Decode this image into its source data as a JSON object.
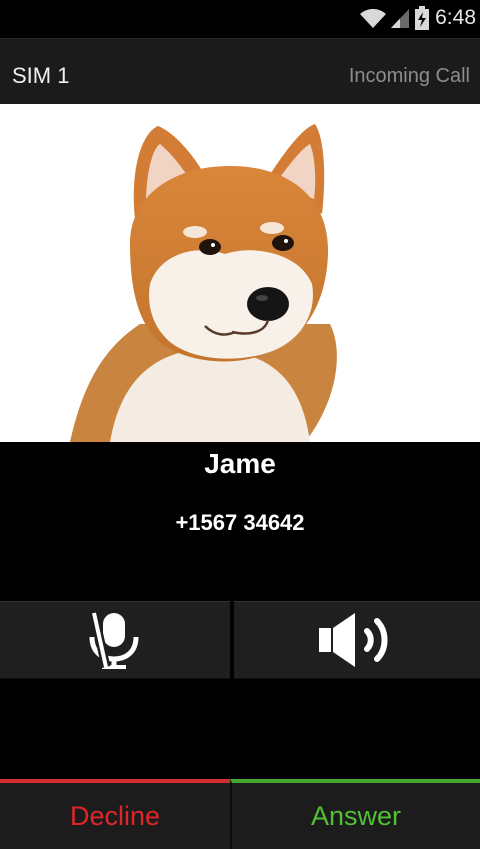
{
  "status_bar": {
    "time": "6:48",
    "icons": [
      "wifi-icon",
      "signal-icon",
      "battery-charging-icon"
    ]
  },
  "header": {
    "sim": "SIM 1",
    "state": "Incoming Call"
  },
  "contact": {
    "name": "Jame",
    "number": "+1567 34642",
    "photo": "shiba-inu-dog-photo"
  },
  "controls": {
    "mute_icon": "mic-muted-icon",
    "speaker_icon": "speaker-icon"
  },
  "actions": {
    "decline": "Decline",
    "answer": "Answer"
  },
  "colors": {
    "decline": "#e0262a",
    "answer": "#52c035",
    "background": "#000000",
    "bar": "#1b1b1b"
  }
}
